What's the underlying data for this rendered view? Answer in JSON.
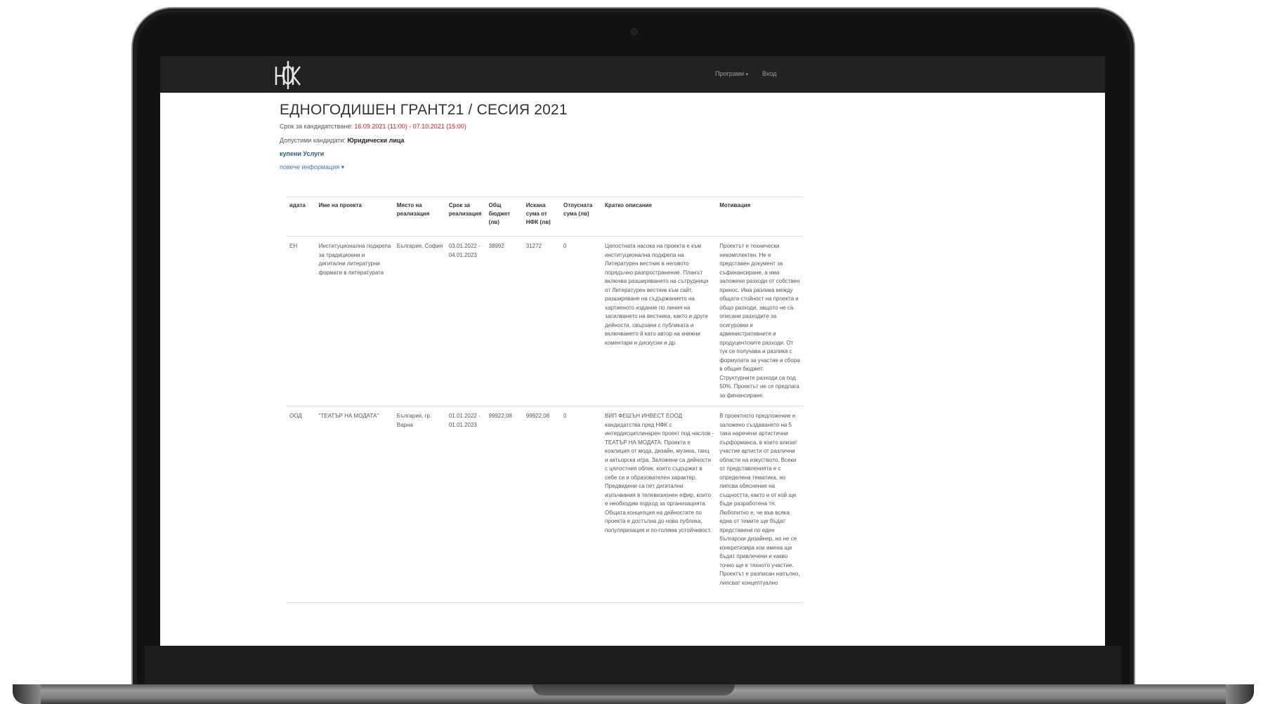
{
  "navbar": {
    "logo_alt": "НФК",
    "programs_label": "Програми",
    "login_label": "Вход"
  },
  "page": {
    "title": "ЕДНОГОДИШЕН ГРАНТ21 / СЕСИЯ 2021",
    "deadline_label": "Срок за кандидатстване:",
    "deadline_value": "16.09.2021 (11:00) - 07.10.2021 (15:00)",
    "eligible_label": "Допустими кандидати:",
    "eligible_value": "Юридически лица",
    "results_link": "купени Услуги",
    "more_info_link": "повече информация"
  },
  "table": {
    "headers": [
      "идата",
      "Име на проекта",
      "Място на реализация",
      "Срок за реализация",
      "Общ бюджет (лв)",
      "Искана сума от НФК (лв)",
      "Отпусната сума (лв)",
      "Кратко описание",
      "Мотивация"
    ],
    "rows": [
      {
        "applicant": "ЕН",
        "project": "Институционална подкрепа за традиционни и дигитални литературни формати в литературата",
        "location": "България, София",
        "period": "03.01.2022 - 04.01.2023",
        "budget": "38992",
        "requested": "31272",
        "granted": "0",
        "description": "Целостната насока на проекта е към институционална подкрепа на Литературен вестник в неговото порядъчно разпространение. Планът включва разширяването на сътрудници от Литературен вестник към сайт, разширяване на съдържанието на хартиеното издание по линия на засилването на вестника, както и други дейности, свързани с публиката и включването й като автор на книжни коментари и дискусии и др.",
        "motivation": "Проектът е технически некомплектен. Не е представен документ за съфинансиране, а има заложени разходи от собствен принос. Има разлика между общата стойност на проекта и общо разходи, защото не са описани разходите за осигуровки и административните и продуцентските разходи. От тук се получава и разлика с формулата за участие и сбора в общия бюджет. Структурните разходи са под 50%. Проектът не се предлага за финансиране."
      },
      {
        "applicant": "ООД",
        "project": "\"ТЕАТЪР НА МОДАТА\"",
        "location": "България, гр. Варна",
        "period": "01.01.2022 - 01.01.2023",
        "budget": "99922,08",
        "requested": "99922,08",
        "granted": "0",
        "description": "ВИП ФЕШЪН ИНВЕСТ ЕООД кандидатства пред НФК с интердисциплинарен проект под наслов - ТЕАТЪР НА МОДАТА. Проекта е коалиция от мода, дизайн, музика, танц и актьорска игра. Заложени са дейности с цялостния облик, които съдържат в себе си и образователен характер. Предвидени са пет дигитални излъчвания в телевизионен ефир, които е необходим подход за организацията. Общата концепция на дейностите по проекта е достъпна до нова публика, популяризация и по-голяма устойчивост.",
        "motivation": "В проектното предложение е заложено създаването на 5 така наречени артистични пърформанса, в които влизат участие артисти от различни области на изкуството. Всеки от представленията е с определена тематика, но липсва обяснение на същността, както и от кой ще бъде разработена тя. Любопитно е, че във всяка една от темите ще бъдат представени по един български дизайнер, но не се конкретизира кои имена ще бъдат привлечени и какво точно ще е тяхното участие. Проектът е разписан напълно, липсват концептуално"
      }
    ]
  }
}
